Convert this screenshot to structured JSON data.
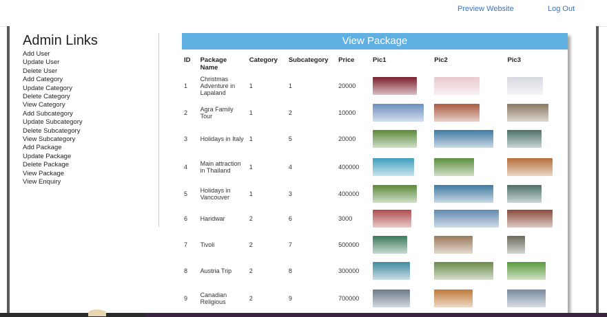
{
  "topbar": {
    "preview_label": "Preview Website",
    "logout_label": "Log Out"
  },
  "sidebar": {
    "title": "Admin Links",
    "links": [
      "Add User",
      "Update User",
      "Delete User",
      "Add Category",
      "Update Category",
      "Delete Category",
      "View Category",
      "Add Subcategory",
      "Update Subcategory",
      "Delete Subcategory",
      "View Subcategory",
      "Add Package",
      "Update Package",
      "Delete Package",
      "View Package",
      "View Enquiry"
    ]
  },
  "panel": {
    "title": "View Package"
  },
  "table": {
    "headers": [
      "ID",
      "Package Name",
      "Category",
      "Subcategory",
      "Price",
      "Pic1",
      "Pic2",
      "Pic3"
    ],
    "rows": [
      {
        "id": "1",
        "name": "Christmas Adventure in Lapaland",
        "category": "1",
        "subcategory": "1",
        "price": "20000"
      },
      {
        "id": "2",
        "name": "Agra Family Tour",
        "category": "1",
        "subcategory": "2",
        "price": "10000"
      },
      {
        "id": "3",
        "name": "Holidays in Italy",
        "category": "1",
        "subcategory": "5",
        "price": "20000"
      },
      {
        "id": "4",
        "name": "Main attraction in Thailand",
        "category": "1",
        "subcategory": "4",
        "price": "400000"
      },
      {
        "id": "5",
        "name": "Holidays in Vancouver",
        "category": "1",
        "subcategory": "3",
        "price": "400000"
      },
      {
        "id": "6",
        "name": "Haridwar",
        "category": "2",
        "subcategory": "6",
        "price": "3000"
      },
      {
        "id": "7",
        "name": "Tivoli",
        "category": "2",
        "subcategory": "7",
        "price": "500000"
      },
      {
        "id": "8",
        "name": "Austria Trip",
        "category": "2",
        "subcategory": "8",
        "price": "300000"
      },
      {
        "id": "9",
        "name": "Canadian Religious",
        "category": "2",
        "subcategory": "9",
        "price": "700000"
      }
    ]
  },
  "thumb_colors": [
    [
      "#7a1e2c",
      "#e8c9cf",
      "#d8d8e0"
    ],
    [
      "#6a8fbf",
      "#a85a42",
      "#8a7760"
    ],
    [
      "#5a8a3a",
      "#3f7aa0",
      "#4a6f6a"
    ],
    [
      "#3fa0c0",
      "#5c8f3e",
      "#b66e3a"
    ],
    [
      "#5a8a3a",
      "#3f7aa0",
      "#4a6f6a"
    ],
    [
      "#b04a4a",
      "#5f8ab0",
      "#8a4a3a"
    ],
    [
      "#3a7a5a",
      "#9a7a5a",
      "#6a6a5a"
    ],
    [
      "#3f8aa0",
      "#6a8a4a",
      "#5a9a3a"
    ],
    [
      "#6a7a8a",
      "#c07a3a",
      "#7a8aa0"
    ]
  ]
}
